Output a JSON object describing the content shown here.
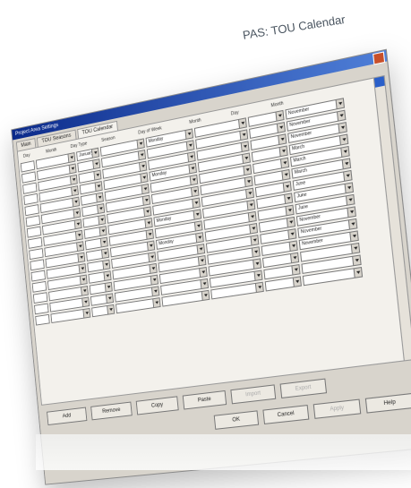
{
  "caption": "PAS: TOU Calendar",
  "window": {
    "title": "Project Area Settings",
    "tabs": [
      "Main",
      "TOU Seasons",
      "TOU Calendar"
    ],
    "active_tab": 2,
    "column_headers": [
      "Day",
      "Month",
      "Day Type",
      "Season",
      "Day of Week",
      "Month",
      "Day",
      "Month"
    ],
    "rows": [
      [
        "",
        "January",
        "",
        "Monday",
        "",
        "",
        "November"
      ],
      [
        "",
        "",
        "",
        "",
        "",
        "",
        "November"
      ],
      [
        "",
        "",
        "",
        "",
        "",
        "",
        "November"
      ],
      [
        "",
        "",
        "",
        "Monday",
        "",
        "",
        "March"
      ],
      [
        "",
        "",
        "",
        "",
        "",
        "",
        "March"
      ],
      [
        "",
        "",
        "",
        "",
        "",
        "",
        "March"
      ],
      [
        "",
        "",
        "",
        "",
        "",
        "",
        "June"
      ],
      [
        "",
        "",
        "",
        "Monday",
        "",
        "",
        "June"
      ],
      [
        "",
        "",
        "",
        "",
        "",
        "",
        "June"
      ],
      [
        "",
        "",
        "",
        "Monday",
        "",
        "",
        "November"
      ],
      [
        "",
        "",
        "",
        "",
        "",
        "",
        "November"
      ],
      [
        "",
        "",
        "",
        "",
        "",
        "",
        "November"
      ],
      [
        "",
        "",
        "",
        "",
        "",
        "",
        ""
      ],
      [
        "",
        "",
        "",
        "",
        "",
        "",
        ""
      ],
      [
        "",
        "",
        "",
        "",
        "",
        "",
        ""
      ]
    ],
    "panel_buttons": [
      "Add",
      "Remove",
      "Copy",
      "Paste",
      "Import",
      "Export"
    ],
    "dialog_buttons": [
      "OK",
      "Cancel",
      "Apply",
      "Help"
    ]
  }
}
